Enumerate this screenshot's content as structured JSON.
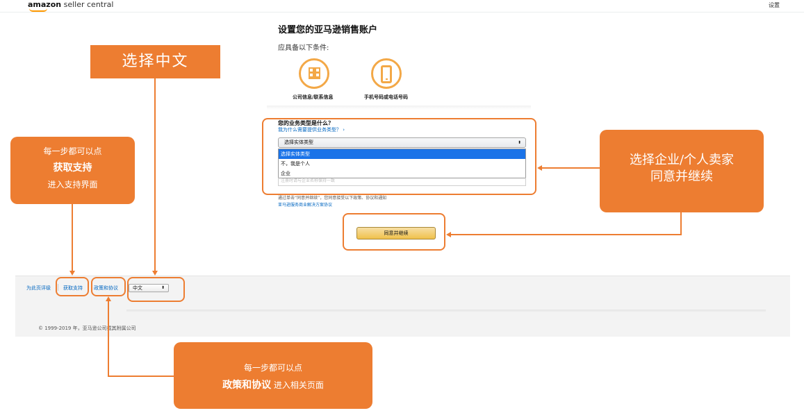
{
  "header": {
    "logo_bold": "amazon",
    "logo_light": " seller central",
    "settings_label": "设置"
  },
  "main": {
    "title": "设置您的亚马逊销售账户",
    "prerequisites_label": "应具备以下条件:",
    "requirements": [
      {
        "icon": "building-icon",
        "label": "公司信息/联系信息"
      },
      {
        "icon": "phone-icon",
        "label": "手机号码或电话号码"
      }
    ],
    "question_title": "您的业务类型是什么？",
    "question_link": "我为什么需要提供业务类型？ ›",
    "select_value": "选择实体类型",
    "dropdown_options": [
      "选择实体类型",
      "不，我是个人",
      "企业"
    ],
    "behind_placeholder": "注册时请与企业名称保持一致",
    "consent_text": "通过单击“同意并继续”，您同意接受以下政策、协议和通知",
    "consent_link": "亚马逊服务商业解决方案协议",
    "continue_label": "同意并继续"
  },
  "footer": {
    "rate_page": "为此页评级",
    "get_support": "获取支持",
    "policies": "政策和协议",
    "language_value": "中文",
    "copyright": "© 1999-2019 年，亚马逊公司或其附属公司"
  },
  "annotations": {
    "choose_chinese": "选择中文",
    "support_line1": "每一步都可以点",
    "support_line2": "获取支持",
    "support_line3": "进入支持界面",
    "seller_line1": "选择企业/个人卖家",
    "seller_line2": "同意并继续",
    "policy_line1": "每一步都可以点",
    "policy_bold": "政策和协议",
    "policy_rest": " 进入相关页面"
  },
  "colors": {
    "annotation_orange": "#ed7d31",
    "link_blue": "#0066c0",
    "button_yellow": "#f0c14b",
    "selected_blue": "#1a73e8"
  }
}
